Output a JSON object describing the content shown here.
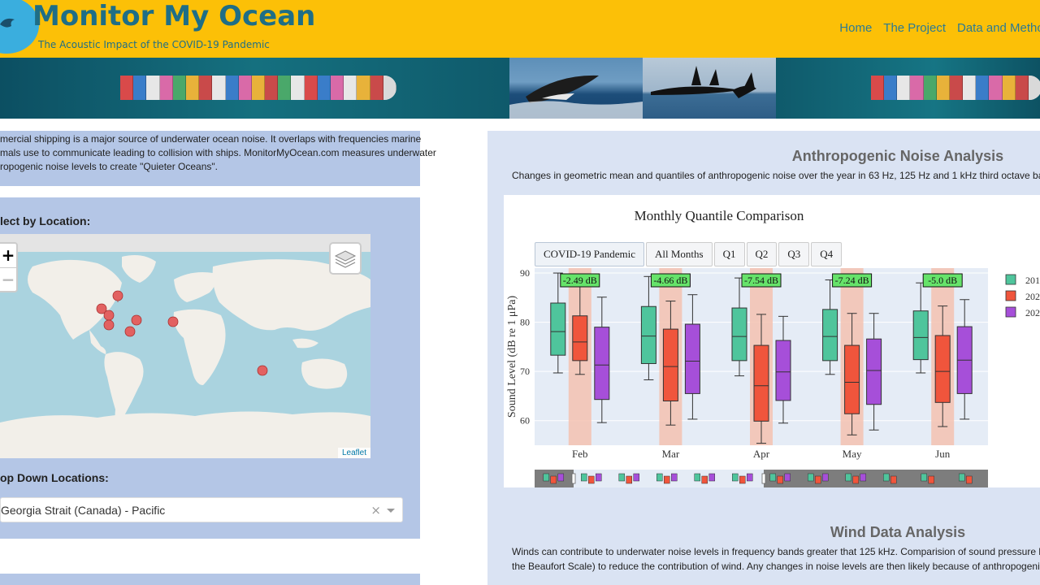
{
  "header": {
    "title": "Monitor My Ocean",
    "subtitle": "The Acoustic Impact of the COVID-19 Pandemic",
    "nav": [
      "Home",
      "The Project",
      "Data and Metho"
    ]
  },
  "intro": {
    "lines": [
      "mercial shipping is a major source of underwater ocean noise. It overlaps with frequencies marine",
      "mals use to communicate leading to collision with ships. MonitorMyOcean.com measures underwater",
      "ropogenic noise levels to create \"Quieter Oceans\"."
    ]
  },
  "location": {
    "label": "lect by Location:",
    "zoom_in": "+",
    "zoom_out": "−",
    "attribution": "Leaflet"
  },
  "dropdown": {
    "label": "op Down Locations:",
    "value": "Georgia Strait (Canada) - Pacific",
    "clear": "×"
  },
  "noise": {
    "title": "Anthropogenic Noise Analysis",
    "description": "Changes in geometric mean and quantiles of anthropogenic noise over the year in 63 Hz, 125 Hz and 1 kHz third octave bands."
  },
  "wind": {
    "title": "Wind Data Analysis",
    "lines": [
      "Winds can contribute to underwater noise levels in frequency bands greater that 125 kHz. Comparision of sound pressure levels we",
      "the Beaufort Scale) to reduce the contribution of wind. Any changes in noise levels are then likely because of anthropogenic reason"
    ]
  },
  "colors": {
    "header_bg": "#fcc007",
    "title_text": "#1f6e86",
    "panel_bg": "#b4c6e6",
    "right_panel_bg": "#dae3f3",
    "series_2019": "#4fc59c",
    "series_2020": "#f0553c",
    "series_2021": "#a64fd9",
    "highlight_band": "#f4c2b0",
    "diff_label_bg": "#66e36a",
    "map_water": "#aad3df",
    "map_land": "#f2efe9",
    "marker": "#e26161"
  },
  "chart_data": {
    "type": "box",
    "title": "Monthly Quantile Comparison",
    "ylabel": "Sound Level (dB re 1 μPa)",
    "ylim": [
      55,
      91
    ],
    "yticks": [
      60,
      70,
      80,
      90
    ],
    "categories": [
      "Feb",
      "Mar",
      "Apr",
      "May",
      "Jun"
    ],
    "buttons": [
      "COVID-19 Pandemic",
      "All Months",
      "Q1",
      "Q2",
      "Q3",
      "Q4"
    ],
    "active_button": "COVID-19 Pandemic",
    "legend": [
      "201",
      "202",
      "202"
    ],
    "diff_labels": [
      "-2.49 dB",
      "-4.66 dB",
      "-7.54 dB",
      "-7.24 dB",
      "-5.0 dB"
    ],
    "series": [
      {
        "name": "201",
        "color": "#4fc59c",
        "boxes": [
          {
            "min": 69.7,
            "q1": 73.3,
            "median": 78.1,
            "q3": 83.9,
            "max": 90.0
          },
          {
            "min": 68.3,
            "q1": 71.6,
            "median": 77.2,
            "q3": 83.2,
            "max": 89.3
          },
          {
            "min": 69.1,
            "q1": 72.2,
            "median": 77.1,
            "q3": 82.9,
            "max": 89.0
          },
          {
            "min": 69.4,
            "q1": 72.2,
            "median": 77.1,
            "q3": 82.6,
            "max": 88.6
          },
          {
            "min": 69.7,
            "q1": 72.4,
            "median": 76.9,
            "q3": 82.3,
            "max": 88.0
          }
        ]
      },
      {
        "name": "202",
        "color": "#f0553c",
        "boxes": [
          {
            "min": 69.4,
            "q1": 72.2,
            "median": 76.0,
            "q3": 81.3,
            "max": 87.8
          },
          {
            "min": 59.1,
            "q1": 64.0,
            "median": 71.0,
            "q3": 78.6,
            "max": 84.3
          },
          {
            "min": 55.4,
            "q1": 59.9,
            "median": 67.1,
            "q3": 75.3,
            "max": 81.6
          },
          {
            "min": 57.1,
            "q1": 61.4,
            "median": 67.8,
            "q3": 75.3,
            "max": 81.8
          },
          {
            "min": 58.8,
            "q1": 63.7,
            "median": 70.0,
            "q3": 77.3,
            "max": 83.3
          }
        ]
      },
      {
        "name": "202",
        "color": "#a64fd9",
        "boxes": [
          {
            "min": 59.6,
            "q1": 64.3,
            "median": 71.3,
            "q3": 79.0,
            "max": 85.1
          },
          {
            "min": 60.3,
            "q1": 65.5,
            "median": 72.1,
            "q3": 79.6,
            "max": 85.6
          },
          {
            "min": 59.5,
            "q1": 64.1,
            "median": 69.9,
            "q3": 76.3,
            "max": 81.2
          },
          {
            "min": 58.1,
            "q1": 63.3,
            "median": 70.2,
            "q3": 76.6,
            "max": 81.8
          },
          {
            "min": 60.3,
            "q1": 65.5,
            "median": 72.3,
            "q3": 79.1,
            "max": 84.6
          }
        ]
      }
    ]
  }
}
